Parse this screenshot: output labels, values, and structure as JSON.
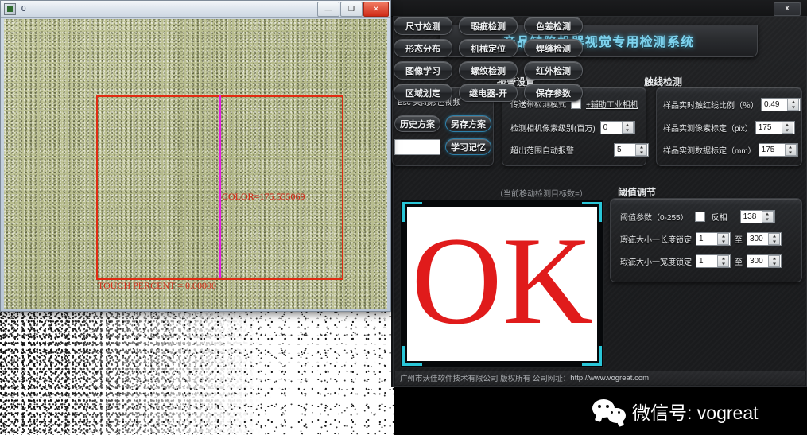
{
  "desktop": {
    "speckle_area_name": "noise-image-background"
  },
  "video_window": {
    "title": "0",
    "icon": "app-icon",
    "buttons": {
      "minimize": "—",
      "maximize": "❐",
      "close": "✕"
    },
    "overlay": {
      "color_label": "COLOR=175.555069",
      "touch_percent_label": "TOUCH PERCENT = 0.00000"
    }
  },
  "app": {
    "close_label": "x",
    "banner_title": "产品缺陷机器视觉专用检测系统",
    "groups": {
      "alarm_title": "报警设置",
      "touch_title": "触线检测",
      "threshold_title": "阈值调节",
      "moving_target_hint": "（当前移动检测目标数=）"
    },
    "left_panel": {
      "esc_hint": "Esc  关闭彩色视频",
      "history_plan_button": "历史方案",
      "save_as_plan_button": "另存方案",
      "learn_memory_button": "学习记忆",
      "text_field_value": ""
    },
    "alarm": {
      "conveyor_mode_label": "传送带检测模式",
      "conveyor_mode_checked": false,
      "aux_camera_label": "+辅助工业相机",
      "camera_pixel_label": "检测相机像素级别(百万)",
      "camera_pixel_value": "0",
      "out_of_range_label": "超出范围自动报警",
      "out_of_range_value": "5"
    },
    "touch": {
      "touch_ratio_label": "样品实时触红线比例（％）",
      "touch_ratio_value": "0.49",
      "pixel_calib_label": "样品实测像素标定（pix）",
      "pixel_calib_value": "175",
      "data_calib_label": "样品实测数据标定（mm）",
      "data_calib_value": "175"
    },
    "threshold": {
      "param_label": "阈值参数（0-255）",
      "invert_label": "反相",
      "invert_checked": false,
      "param_value": "138",
      "length_lock_label": "瑕疵大小一长度锁定",
      "length_min": "1",
      "length_to": "至",
      "length_max": "300",
      "width_lock_label": "瑕疵大小一宽度锁定",
      "width_min": "1",
      "width_to": "至",
      "width_max": "300"
    },
    "function_buttons": [
      "尺寸检测",
      "瑕疵检测",
      "色差检测",
      "形态分布",
      "机械定位",
      "焊缝检测",
      "图像学习",
      "螺纹检测",
      "红外检测",
      "区域划定",
      "继电器-开",
      "保存参数"
    ],
    "result": {
      "text": "OK"
    },
    "footer": {
      "company": "广州市沃佳软件技术有限公司  版权所有  公司网址：",
      "url": "http://www.vogreat.com"
    }
  },
  "watermark": {
    "text": "微信号: vogreat",
    "logo": "wechat-icon"
  },
  "colors": {
    "accent_cyan": "#29c6d8",
    "banner_text": "#7fd4ef",
    "result_red": "#e01b1b",
    "roi_red": "#e02b12",
    "roi_line_magenta": "#e61ee6"
  }
}
